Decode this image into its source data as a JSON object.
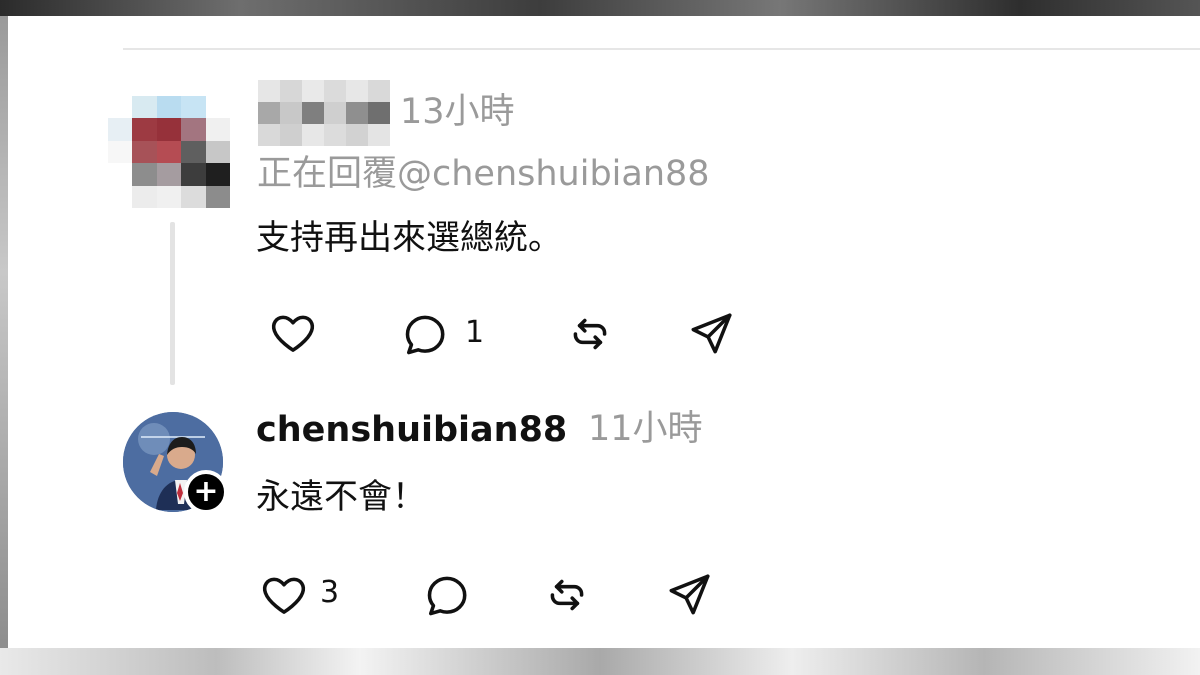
{
  "colors": {
    "text_primary": "#111111",
    "text_secondary": "#9a9a9a",
    "divider": "#e6e6e6",
    "thread_line": "#e3e3e3"
  },
  "post_1": {
    "time": "13小時",
    "reply_to": "正在回覆@chenshuibian88",
    "text": "支持再出來選總統。",
    "actions": {
      "like_icon": "heart-icon",
      "comment_icon": "comment-icon",
      "comment_count": "1",
      "repost_icon": "repost-icon",
      "share_icon": "send-icon"
    }
  },
  "post_2": {
    "username": "chenshuibian88",
    "time": "11小時",
    "text": "永遠不會！",
    "actions": {
      "like_icon": "heart-icon",
      "like_count": "3",
      "comment_icon": "comment-icon",
      "repost_icon": "repost-icon",
      "share_icon": "send-icon"
    },
    "follow_badge": "+"
  }
}
